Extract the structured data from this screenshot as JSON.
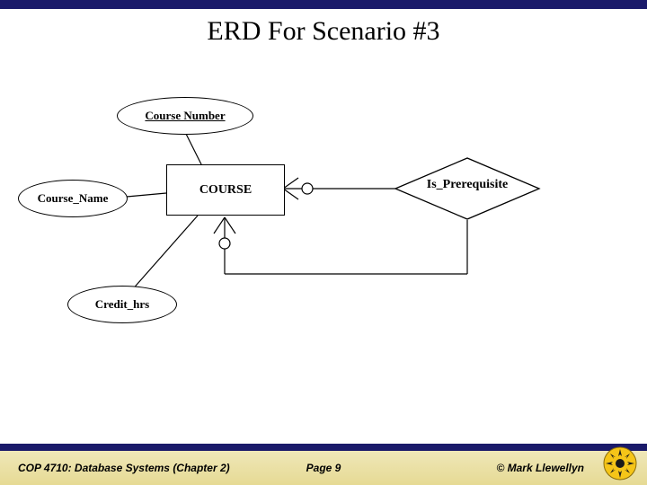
{
  "title": "ERD For Scenario #3",
  "chart_data": {
    "type": "er-diagram",
    "title": "ERD For Scenario #3",
    "entities": [
      {
        "name": "COURSE"
      }
    ],
    "attributes": [
      {
        "name": "Course Number",
        "of": "COURSE",
        "key": true
      },
      {
        "name": "Course_Name",
        "of": "COURSE",
        "key": false
      },
      {
        "name": "Credit_hrs",
        "of": "COURSE",
        "key": false
      }
    ],
    "relationships": [
      {
        "name": "Is_Prerequisite",
        "participants": [
          {
            "entity": "COURSE",
            "cardinality": "zero-or-many"
          },
          {
            "entity": "COURSE",
            "cardinality": "zero-or-many"
          }
        ],
        "recursive": true
      }
    ]
  },
  "erd": {
    "entity_label": "COURSE",
    "attr_course_number": "Course Number",
    "attr_course_name": "Course_Name",
    "attr_credit_hrs": "Credit_hrs",
    "relationship_label": "Is_Prerequisite"
  },
  "footer": {
    "left": "COP 4710: Database Systems  (Chapter 2)",
    "mid": "Page 9",
    "right": "© Mark Llewellyn"
  }
}
